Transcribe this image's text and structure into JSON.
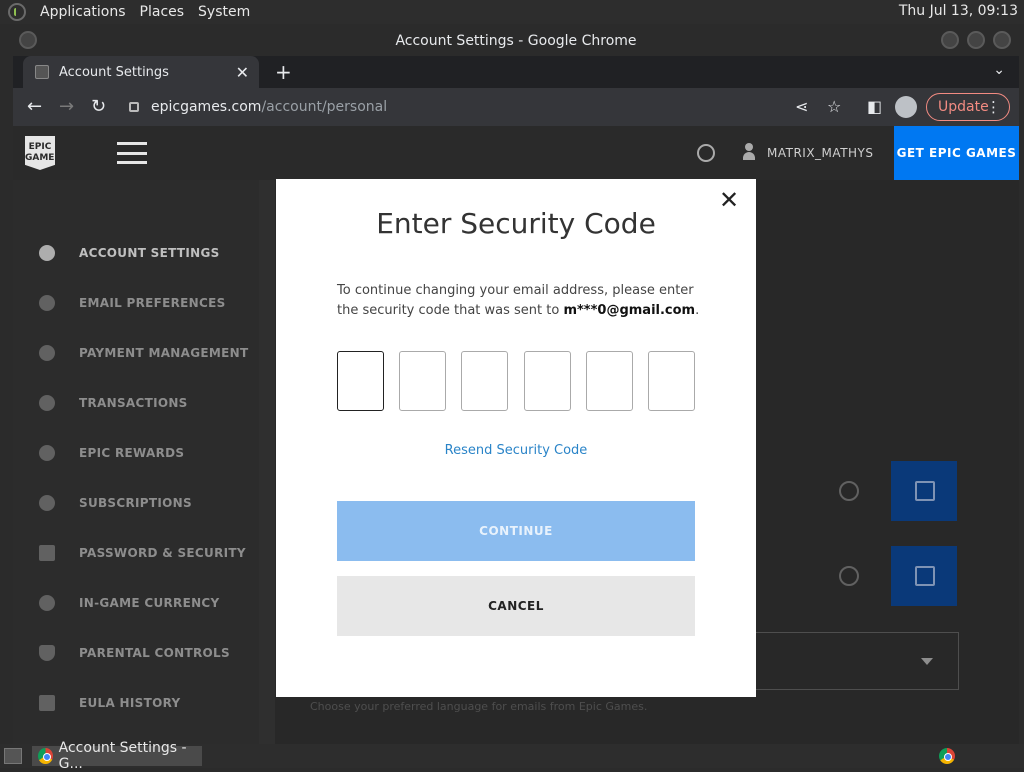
{
  "desktop": {
    "menu": [
      "Applications",
      "Places",
      "System"
    ],
    "clock": "Thu Jul 13, 09:13",
    "taskbar_item": "Account Settings - G..."
  },
  "browser": {
    "window_title": "Account Settings - Google Chrome",
    "tab_title": "Account Settings",
    "url_domain": "epicgames.com",
    "url_path": "/account/personal",
    "update_label": "Update"
  },
  "epic": {
    "logo_text": "EPIC GAMES",
    "username": "MATRIX_MATHYS",
    "get_epic": "GET EPIC GAMES",
    "nav": [
      {
        "label": "ACCOUNT SETTINGS",
        "icon": "user-icon"
      },
      {
        "label": "EMAIL PREFERENCES",
        "icon": "bell-icon"
      },
      {
        "label": "PAYMENT MANAGEMENT",
        "icon": "dollar-icon"
      },
      {
        "label": "TRANSACTIONS",
        "icon": "clock-icon"
      },
      {
        "label": "EPIC REWARDS",
        "icon": "rewards-icon"
      },
      {
        "label": "SUBSCRIPTIONS",
        "icon": "subscriptions-icon"
      },
      {
        "label": "PASSWORD & SECURITY",
        "icon": "lock-icon"
      },
      {
        "label": "IN-GAME CURRENCY",
        "icon": "currency-icon"
      },
      {
        "label": "PARENTAL CONTROLS",
        "icon": "shield-icon"
      },
      {
        "label": "EULA HISTORY",
        "icon": "document-icon"
      }
    ],
    "active_nav": "ACCOUNT SETTINGS",
    "hint_text": "Choose your preferred language for emails from Epic Games."
  },
  "modal": {
    "title": "Enter Security Code",
    "desc_prefix": "To continue changing your email address, please enter the security code that was sent to ",
    "email": "m***0@gmail.com",
    "desc_suffix": ".",
    "code_digits": [
      "",
      "",
      "",
      "",
      "",
      ""
    ],
    "resend_label": "Resend Security Code",
    "continue_label": "CONTINUE",
    "cancel_label": "CANCEL",
    "close_glyph": "✕"
  },
  "colors": {
    "accent_blue": "#0078f2",
    "continue_disabled": "#8bbcef",
    "link": "#2a84c8"
  }
}
